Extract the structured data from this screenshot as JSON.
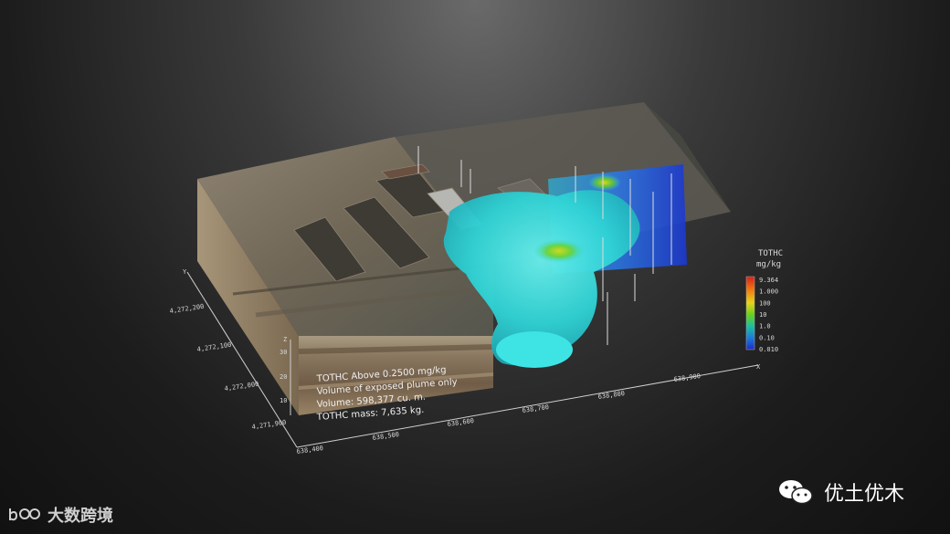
{
  "overlay": {
    "line1": "TOTHC Above 0.2500 mg/kg",
    "line2": "Volume of exposed plume only",
    "line3": "Volume: 598,377 cu. m.",
    "line4": "TOTHC mass: 7,635 kg."
  },
  "legend": {
    "title": "TOTHC",
    "unit": "mg/kg",
    "ticks": [
      "9.364",
      "1.000",
      "100",
      "10",
      "1.0",
      "0.10",
      "0.010"
    ],
    "colors": [
      "#d8201c",
      "#f07a10",
      "#e6d41c",
      "#6cd01c",
      "#1cc0a0",
      "#1c7ad8",
      "#1c2cc8"
    ]
  },
  "axes": {
    "y_ticks": [
      "4,272,200",
      "4,272,100",
      "4,272,000",
      "4,271,900"
    ],
    "x_ticks": [
      "638,400",
      "638,500",
      "638,600",
      "638,700",
      "638,800",
      "638,900"
    ],
    "z_ticks": [
      "30",
      "20",
      "10"
    ],
    "y_label": "Y",
    "x_label": "X",
    "z_label": "Z"
  },
  "brand_left": {
    "text": "大数跨境",
    "logo_text": "100"
  },
  "brand_right": {
    "text": "优土优木"
  },
  "colors": {
    "plume": "#2ed6d8",
    "ground": "#7b6c58",
    "soil_dark": "#6b5a45",
    "soil_light": "#8c7b63"
  }
}
